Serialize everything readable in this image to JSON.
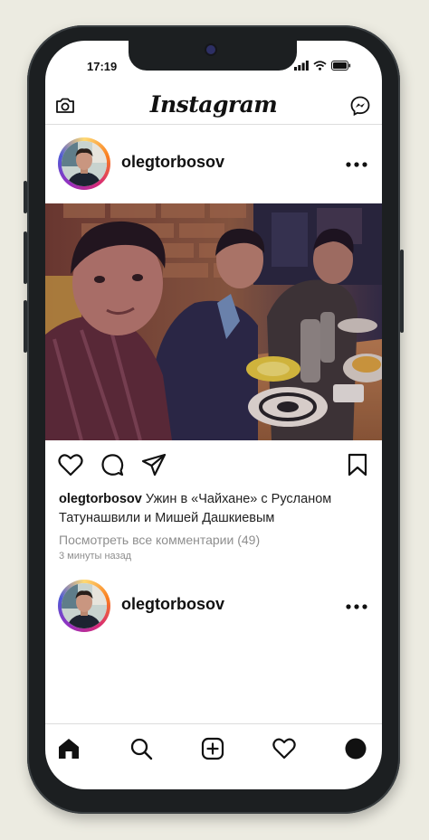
{
  "status_bar": {
    "time": "17:19"
  },
  "header": {
    "logo": "Instagram",
    "camera_icon": "camera-icon",
    "messenger_icon": "messenger-icon"
  },
  "posts": [
    {
      "username": "olegtorbosov",
      "caption_text": "Ужин в «Чайхане» с Русланом Татунашвили и Мишей Дашкиевым",
      "view_comments": "Посмотреть все комментарии (49)",
      "time_ago": "3 минуты назад"
    },
    {
      "username": "olegtorbosov"
    }
  ],
  "actions": [
    "heart-icon",
    "comment-icon",
    "share-icon",
    "bookmark-icon"
  ],
  "bottom_nav": [
    "home-icon",
    "search-icon",
    "add-post-icon",
    "activity-heart-icon",
    "profile-icon"
  ],
  "colors": {
    "frame": "#1c1f21",
    "background": "#ecebe1",
    "text": "#111111",
    "muted": "#8e8e8e"
  }
}
